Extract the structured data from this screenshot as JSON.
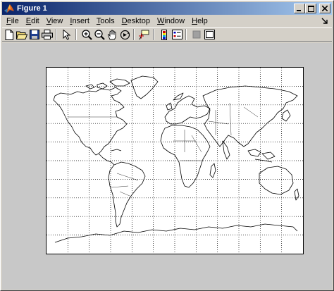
{
  "window": {
    "title": "Figure 1",
    "colors": {
      "titlebar_start": "#0a246a",
      "titlebar_end": "#a6caf0",
      "chrome": "#d4d0c8",
      "figure_background": "#c8c8c8"
    }
  },
  "title_buttons": [
    {
      "name": "minimize-button",
      "icon": "minimize-icon"
    },
    {
      "name": "maximize-button",
      "icon": "maximize-icon"
    },
    {
      "name": "close-button",
      "icon": "close-icon"
    }
  ],
  "menu": {
    "items": [
      {
        "label": "File",
        "mnemonic": "F"
      },
      {
        "label": "Edit",
        "mnemonic": "E"
      },
      {
        "label": "View",
        "mnemonic": "V"
      },
      {
        "label": "Insert",
        "mnemonic": "I"
      },
      {
        "label": "Tools",
        "mnemonic": "T"
      },
      {
        "label": "Desktop",
        "mnemonic": "D"
      },
      {
        "label": "Window",
        "mnemonic": "W"
      },
      {
        "label": "Help",
        "mnemonic": "H"
      }
    ],
    "dock_icon": "dock-arrow-icon"
  },
  "toolbar": {
    "groups": [
      [
        "new-figure-icon",
        "open-file-icon",
        "save-icon",
        "print-icon"
      ],
      [
        "edit-plot-arrow-icon"
      ],
      [
        "zoom-in-icon",
        "zoom-out-icon",
        "pan-hand-icon",
        "rotate-3d-icon"
      ],
      [
        "data-cursor-icon"
      ],
      [
        "insert-colorbar-icon",
        "insert-legend-icon"
      ],
      [
        "hide-plot-tools-icon",
        "show-plot-tools-icon"
      ]
    ]
  },
  "axes": {
    "grid": "dotted",
    "grid_color": "#000000",
    "content": "world coastline map",
    "vertical_gridlines": 12,
    "horizontal_gridlines": 10
  }
}
